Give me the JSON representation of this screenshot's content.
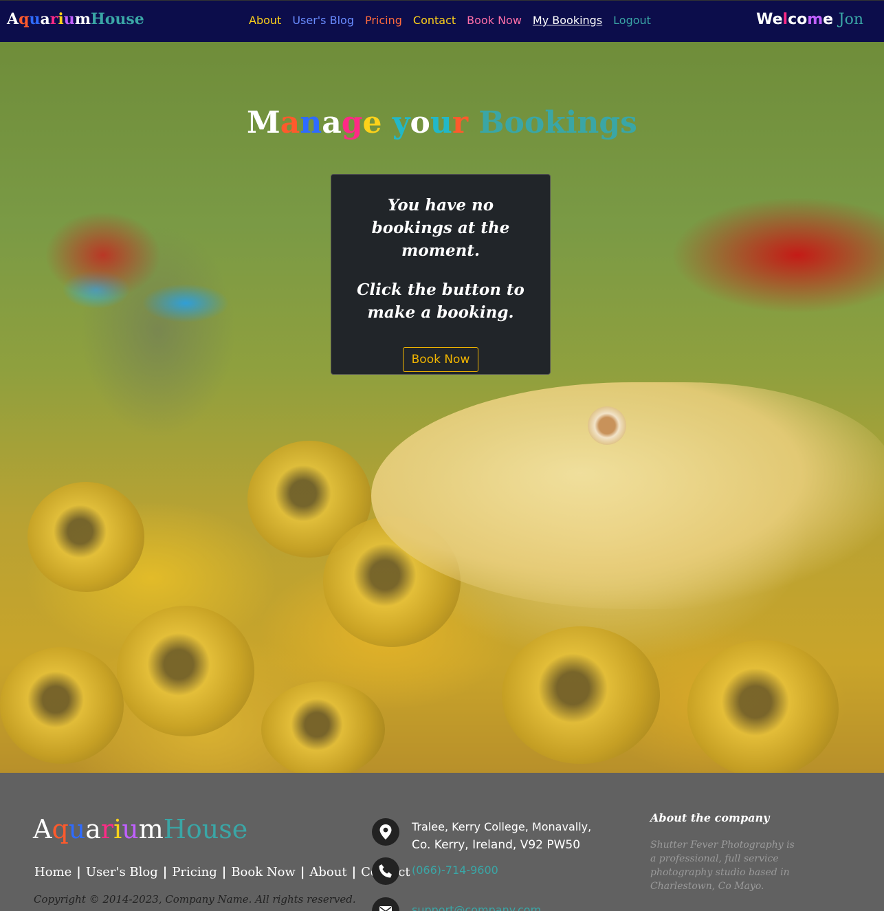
{
  "brand": {
    "part1": "Aquarium",
    "part2": "House",
    "letters1": [
      {
        "ch": "A",
        "color": "#ffffff"
      },
      {
        "ch": "q",
        "color": "#ff5a2c"
      },
      {
        "ch": "u",
        "color": "#2f6bff"
      },
      {
        "ch": "a",
        "color": "#ffffff"
      },
      {
        "ch": "r",
        "color": "#ff2a86"
      },
      {
        "ch": "i",
        "color": "#ffd21a"
      },
      {
        "ch": "u",
        "color": "#c060ff"
      },
      {
        "ch": "m",
        "color": "#ffffff"
      }
    ],
    "part2_color": "#3aa6a6"
  },
  "nav": {
    "items": [
      {
        "label": "About",
        "color": "#ffd21a"
      },
      {
        "label": "User's Blog",
        "color": "#6a8cff"
      },
      {
        "label": "Pricing",
        "color": "#ff6a3c"
      },
      {
        "label": "Contact",
        "color": "#ffd21a"
      },
      {
        "label": "Book Now",
        "color": "#ff6fa8"
      },
      {
        "label": "My Bookings",
        "color": "#ffffff",
        "active": true
      },
      {
        "label": "Logout",
        "color": "#3aa6a6"
      }
    ]
  },
  "welcome": {
    "greeting": "Welcome",
    "name": "Jon",
    "name_color": "#3aa6a6"
  },
  "hero": {
    "title_word1": "Manage",
    "title_word2": "your",
    "title_word3": "Bookings",
    "title_word1_colors": [
      "#ffffff",
      "#ff5a2c",
      "#2f6bff",
      "#ffffff",
      "#ff2a86",
      "#ffd21a"
    ],
    "title_word2_colors": [
      "#22b8c8",
      "#ffffff",
      "#22b8c8",
      "#ff5a2c"
    ],
    "title_word3_color": "#3aa6a6"
  },
  "card": {
    "message1": "You have no bookings at the moment.",
    "message2": "Click the button to make a booking.",
    "button_label": "Book Now",
    "button_color": "#f0b400"
  },
  "footer": {
    "links": [
      "Home",
      "User's Blog",
      "Pricing",
      "Book Now",
      "About",
      "Contact"
    ],
    "copyright": "Copyright © 2014-2023, Company Name. All rights reserved.",
    "address_line1": "Tralee, Kerry College, Monavally,",
    "address_line2": "Co. Kerry, Ireland, V92 PW50",
    "phone": "(066)-714-9600",
    "email": "support@company.com",
    "about_title": "About the company",
    "about_text": "Shutter Fever Photography is a professional, full service photography studio based in Charlestown, Co Mayo."
  }
}
